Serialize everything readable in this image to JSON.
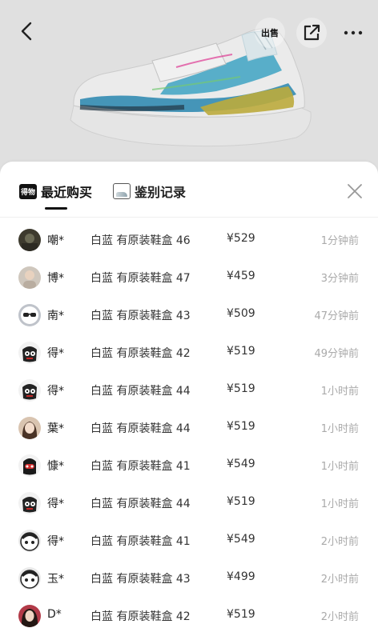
{
  "top_bar": {
    "sell_label": "出售",
    "icons": [
      "back-arrow-icon",
      "share-icon",
      "more-icon"
    ]
  },
  "product": {
    "image": "sneaker-photo"
  },
  "sheet": {
    "tabs": [
      {
        "label": "最近购买",
        "icon": "dewu-logo-icon",
        "icon_text": "得物",
        "active": true
      },
      {
        "label": "鉴别记录",
        "icon": "sneaker-box-icon",
        "active": false
      }
    ],
    "close_icon": "close-icon",
    "records": [
      {
        "avatar": "avatar-photo-dark",
        "name": "嘲*",
        "spec": "白蓝 有原装鞋盒 46",
        "price": "¥529",
        "time": "1分钟前"
      },
      {
        "avatar": "avatar-photo-person",
        "name": "博*",
        "spec": "白蓝 有原装鞋盒 47",
        "price": "¥459",
        "time": "3分钟前"
      },
      {
        "avatar": "avatar-glasses-cartoon",
        "name": "南*",
        "spec": "白蓝 有原装鞋盒 43",
        "price": "¥509",
        "time": "47分钟前"
      },
      {
        "avatar": "avatar-cartoon-black",
        "name": "得*",
        "spec": "白蓝 有原装鞋盒 42",
        "price": "¥519",
        "time": "49分钟前"
      },
      {
        "avatar": "avatar-cartoon-black",
        "name": "得*",
        "spec": "白蓝 有原装鞋盒 44",
        "price": "¥519",
        "time": "1小时前"
      },
      {
        "avatar": "avatar-photo-girl",
        "name": "葉*",
        "spec": "白蓝 有原装鞋盒 44",
        "price": "¥519",
        "time": "1小时前"
      },
      {
        "avatar": "avatar-cartoon-red",
        "name": "慷*",
        "spec": "白蓝 有原装鞋盒 41",
        "price": "¥549",
        "time": "1小时前"
      },
      {
        "avatar": "avatar-cartoon-black",
        "name": "得*",
        "spec": "白蓝 有原装鞋盒 44",
        "price": "¥519",
        "time": "1小时前"
      },
      {
        "avatar": "avatar-cartoon-white",
        "name": "得*",
        "spec": "白蓝 有原装鞋盒 41",
        "price": "¥549",
        "time": "2小时前"
      },
      {
        "avatar": "avatar-cartoon-white",
        "name": "玉*",
        "spec": "白蓝 有原装鞋盒 43",
        "price": "¥499",
        "time": "2小时前"
      },
      {
        "avatar": "avatar-photo-woman",
        "name": "D*",
        "spec": "白蓝 有原装鞋盒 42",
        "price": "¥519",
        "time": "2小时前"
      }
    ]
  },
  "colors": {
    "text": "#222222",
    "muted": "#aaaaaa",
    "sheet_bg": "#ffffff",
    "accent": "#111111"
  }
}
